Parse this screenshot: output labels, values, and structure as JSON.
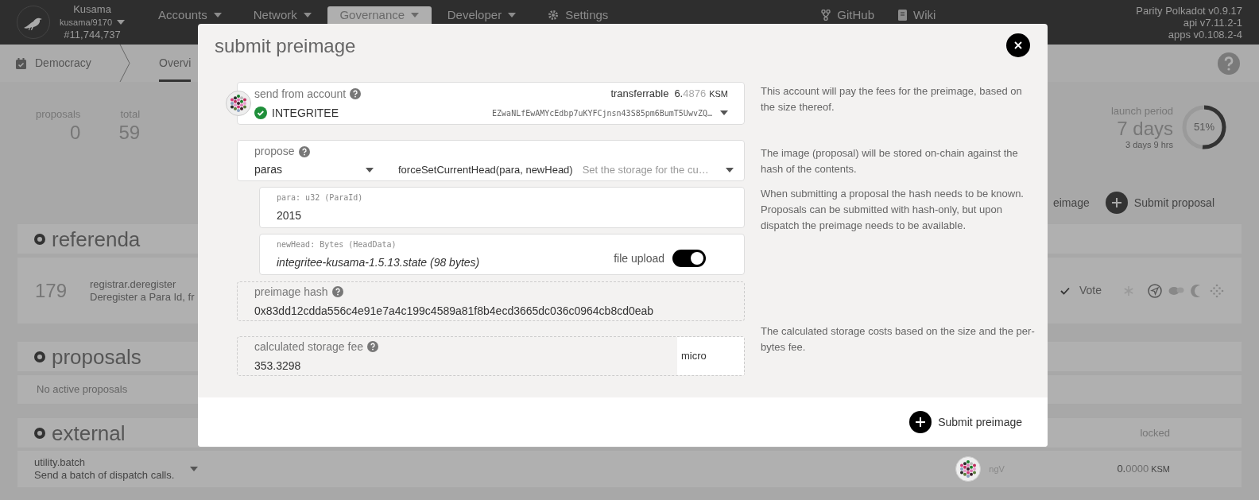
{
  "topbar": {
    "chain": {
      "name": "Kusama",
      "runtime": "kusama/9170",
      "block": "#11,744,737"
    },
    "menu": [
      {
        "label": "Accounts",
        "selected": false,
        "kind": "dropdown"
      },
      {
        "label": "Network",
        "selected": false,
        "kind": "dropdown"
      },
      {
        "label": "Governance",
        "selected": true,
        "kind": "dropdown"
      },
      {
        "label": "Developer",
        "selected": false,
        "kind": "dropdown"
      },
      {
        "label": "Settings",
        "selected": false,
        "kind": "settings"
      }
    ],
    "links": [
      {
        "label": "GitHub",
        "kind": "github"
      },
      {
        "label": "Wiki",
        "kind": "wiki"
      }
    ],
    "versions": [
      "Parity Polkadot v0.9.17",
      "api v7.11.2-1",
      "apps v0.108.2-4"
    ]
  },
  "subnav": {
    "section": "Democracy",
    "tabs": [
      {
        "label": "Overvi",
        "selected": true
      }
    ]
  },
  "summary": {
    "stats": [
      {
        "label": "proposals",
        "value": "0"
      },
      {
        "label": "total",
        "value": "59"
      }
    ],
    "launch_period": {
      "label": "launch period",
      "value": "7 days",
      "remaining": "3 days 9 hrs",
      "level": 0.51,
      "reading": "51%"
    }
  },
  "actions": [
    {
      "label": "eimage",
      "kind": "text"
    },
    {
      "label": "Submit proposal",
      "kind": "plus"
    }
  ],
  "referenda": {
    "title": "referenda",
    "rows": [
      {
        "index": "179",
        "call": "registrar.deregister",
        "description": "Deregister a Para Id, fr",
        "vote": "Vote"
      }
    ]
  },
  "proposals": {
    "title": "proposals",
    "empty": "No active proposals"
  },
  "external": {
    "title": "external",
    "column": "locked",
    "rows": [
      {
        "call": "utility.batch",
        "description": "Send a batch of dispatch calls.",
        "proposer": "ngV",
        "locked_int": "0.",
        "locked_frac": "0000",
        "unit": "KSM"
      }
    ]
  },
  "modal": {
    "title": "submit preimage",
    "account": {
      "label": "send from account",
      "name": "INTEGRITEE",
      "verified": true,
      "address": "EZwaNLfEwAMYcEdbp7uKYFCjnsn43S85pm6BumT5UwvZQ…",
      "balance_label": "transferrable",
      "balance_int": "6.",
      "balance_frac": "4876",
      "unit": "KSM"
    },
    "propose": {
      "label": "propose",
      "section": "paras",
      "method": "forceSetCurrentHead(para, newHead)",
      "description": "Set the storage for the cu…"
    },
    "params": [
      {
        "label": "para: u32 (ParaId)",
        "value": "2015",
        "kind": "text"
      },
      {
        "label": "newHead: Bytes (HeadData)",
        "value": "integritee-kusama-1.5.13.state (98 bytes)",
        "kind": "file",
        "toggle_label": "file upload",
        "on": true
      }
    ],
    "hash": {
      "label": "preimage hash",
      "value": "0x83dd12cdda556c4e91e7a4c199c4589a81f8b4ecd3665dc036c0964cb8cd0eab"
    },
    "fee": {
      "label": "calculated storage fee",
      "value": "353.3298",
      "unit": "micro"
    },
    "help": [
      "This account will pay the fees for the preimage, based on the size thereof.",
      "The image (proposal) will be stored on-chain against the hash of the contents.",
      "When submitting a proposal the hash needs to be known. Proposals can be submitted with hash-only, but upon dispatch the preimage needs to be available.",
      "The calculated storage costs based on the size and the per-bytes fee."
    ],
    "submit": "Submit preimage"
  }
}
